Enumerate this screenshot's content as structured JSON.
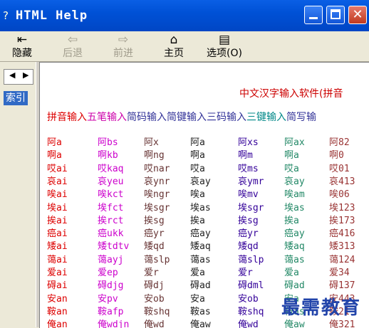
{
  "window": {
    "title": "HTML Help"
  },
  "toolbar": {
    "hide": "隐藏",
    "back": "后退",
    "forward": "前进",
    "home": "主页",
    "options": "选项(O)"
  },
  "nav": {
    "tab": "索引"
  },
  "content": {
    "heading": "中文汉字输入软件(拼音",
    "methods": [
      "拼音输入",
      "五笔输入",
      "简码输入",
      "简键输入",
      "三码输入",
      "三键输入",
      "简写输"
    ],
    "method_colors": [
      "#DD0000",
      "#CC00AA",
      "#333399",
      "#333399",
      "#333399",
      "#008888",
      "#333399"
    ],
    "column_colors": [
      "#DD0000",
      "#CC00CC",
      "#663333",
      "#222222",
      "#330099",
      "#228866",
      "#993333"
    ],
    "rows": [
      [
        "阿a",
        "阿bs",
        "阿x",
        "阿a",
        "阿xs",
        "阿ax",
        "阿82"
      ],
      [
        "啊a",
        "啊kb",
        "啊ng",
        "啊a",
        "啊m",
        "啊a",
        "啊0"
      ],
      [
        "哎ai",
        "哎kaq",
        "哎nar",
        "哎a",
        "哎ms",
        "哎a",
        "哎01"
      ],
      [
        "哀ai",
        "哀yeu",
        "哀ynr",
        "哀ay",
        "哀ymr",
        "哀ay",
        "哀413"
      ],
      [
        "唉ai",
        "唉kct",
        "唉ngr",
        "唉a",
        "唉mv",
        "唉am",
        "唉06"
      ],
      [
        "埃ai",
        "埃fct",
        "埃sgr",
        "埃as",
        "埃sgr",
        "埃as",
        "埃123"
      ],
      [
        "挨ai",
        "挨rct",
        "挨sg",
        "挨a",
        "挨sg",
        "挨a",
        "挨173"
      ],
      [
        "癌ai",
        "癌ukk",
        "癌yr",
        "癌ay",
        "癌yr",
        "癌ay",
        "癌416"
      ],
      [
        "矮ai",
        "矮tdtv",
        "矮qd",
        "矮aq",
        "矮qd",
        "矮aq",
        "矮313"
      ],
      [
        "蔼ai",
        "蔼ayj",
        "蔼slp",
        "蔼as",
        "蔼slp",
        "蔼as",
        "蔼124"
      ],
      [
        "爱ai",
        "爱ep",
        "爱r",
        "爱a",
        "爱r",
        "爱a",
        "爱34"
      ],
      [
        "碍ai",
        "碍djg",
        "碍dj",
        "碍ad",
        "碍dml",
        "碍ad",
        "碍137"
      ],
      [
        "安an",
        "安pv",
        "安ob",
        "安a",
        "安ob",
        "安a",
        "安443"
      ],
      [
        "鞍an",
        "鞍afp",
        "鞍shq",
        "鞍as",
        "鞍shq",
        "鞍as",
        "鞍21"
      ],
      [
        "俺an",
        "俺wdjn",
        "俺wd",
        "俺aw",
        "俺wd",
        "俺aw",
        "俺321"
      ]
    ]
  },
  "watermark": "最需教育"
}
